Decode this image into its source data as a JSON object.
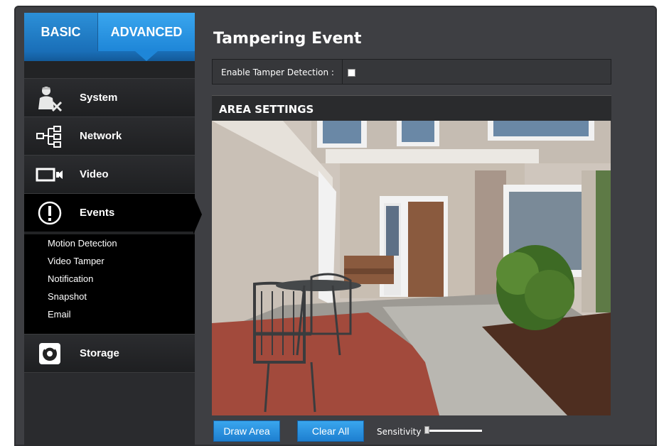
{
  "tabs": {
    "basic": "BASIC",
    "advanced": "ADVANCED"
  },
  "menu": {
    "system": "System",
    "network": "Network",
    "video": "Video",
    "events": "Events",
    "storage": "Storage"
  },
  "events_submenu": [
    "Motion Detection",
    "Video Tamper",
    "Notification",
    "Snapshot",
    "Email"
  ],
  "main": {
    "title": "Tampering Event",
    "enable_label": "Enable Tamper Detection :",
    "enable_checked": false,
    "area_header": "AREA SETTINGS"
  },
  "buttons": {
    "draw_area": "Draw Area",
    "clear_all": "Clear All"
  },
  "sensitivity": {
    "label": "Sensitivity",
    "value": 0
  },
  "colors": {
    "accent": "#2c90d8",
    "panel": "#3e3f43",
    "sidebar": "#222325"
  }
}
